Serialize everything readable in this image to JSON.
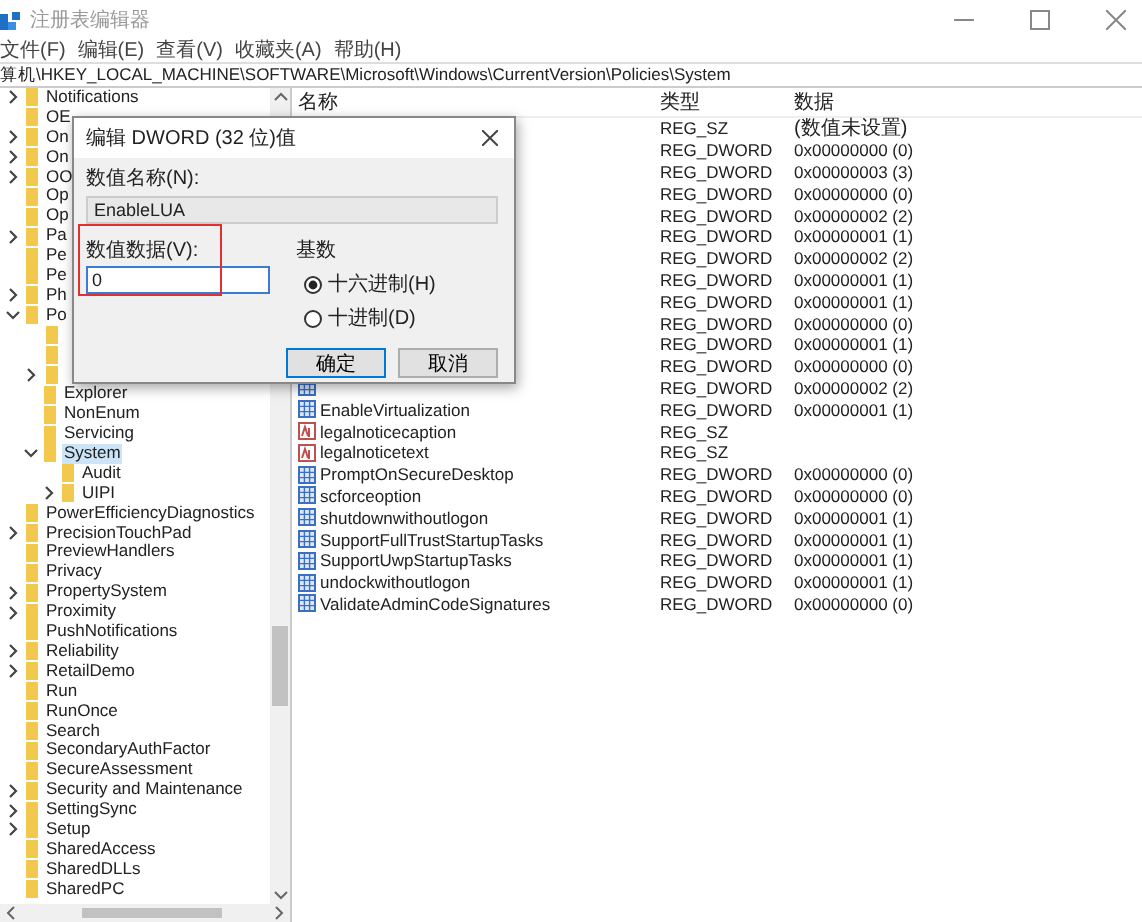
{
  "window": {
    "title": "注册表编辑器"
  },
  "menu": [
    "文件(F)",
    "编辑(E)",
    "查看(V)",
    "收藏夹(A)",
    "帮助(H)"
  ],
  "address": "算机\\HKEY_LOCAL_MACHINE\\SOFTWARE\\Microsoft\\Windows\\CurrentVersion\\Policies\\System",
  "tree": [
    {
      "name": "Notifications",
      "expanded": false,
      "selected": false
    },
    {
      "name": "OE",
      "selected": false
    },
    {
      "name": "On",
      "expanded": false,
      "selected": false
    },
    {
      "name": "On",
      "expanded": false,
      "selected": false
    },
    {
      "name": "OO",
      "expanded": false,
      "selected": false
    },
    {
      "name": "Op",
      "selected": false
    },
    {
      "name": "Op",
      "selected": false
    },
    {
      "name": "Pa",
      "expanded": false,
      "selected": false
    },
    {
      "name": "Pe",
      "selected": false
    },
    {
      "name": "Pe",
      "selected": false
    },
    {
      "name": "Ph",
      "expanded": false,
      "selected": false
    },
    {
      "name": "Po",
      "expanded": true,
      "selected": false,
      "children": [
        {
          "selected": false
        },
        {
          "selected": false
        },
        {
          "expanded": false,
          "selected": false
        },
        {
          "name": "Explorer",
          "selected": false
        },
        {
          "name": "NonEnum",
          "selected": false
        },
        {
          "name": "Servicing",
          "selected": false
        },
        {
          "name": "System",
          "expanded": true,
          "selected": true,
          "children": [
            {
              "name": "Audit",
              "selected": false
            },
            {
              "name": "UIPI",
              "expanded": false,
              "selected": false
            }
          ]
        }
      ]
    },
    {
      "name": "PowerEfficiencyDiagnostics",
      "selected": false
    },
    {
      "name": "PrecisionTouchPad",
      "expanded": false,
      "selected": false
    },
    {
      "name": "PreviewHandlers",
      "selected": false
    },
    {
      "name": "Privacy",
      "selected": false
    },
    {
      "name": "PropertySystem",
      "expanded": false,
      "selected": false
    },
    {
      "name": "Proximity",
      "expanded": false,
      "selected": false
    },
    {
      "name": "PushNotifications",
      "selected": false
    },
    {
      "name": "Reliability",
      "expanded": false,
      "selected": false
    },
    {
      "name": "RetailDemo",
      "expanded": false,
      "selected": false
    },
    {
      "name": "Run",
      "selected": false
    },
    {
      "name": "RunOnce",
      "selected": false
    },
    {
      "name": "Search",
      "selected": false
    },
    {
      "name": "SecondaryAuthFactor",
      "selected": false
    },
    {
      "name": "SecureAssessment",
      "selected": false
    },
    {
      "name": "Security and Maintenance",
      "expanded": false,
      "selected": false
    },
    {
      "name": "SettingSync",
      "expanded": false,
      "selected": false
    },
    {
      "name": "Setup",
      "expanded": false,
      "selected": false
    },
    {
      "name": "SharedAccess",
      "selected": false
    },
    {
      "name": "SharedDLLs",
      "selected": false
    },
    {
      "name": "SharedPC",
      "selected": false
    }
  ],
  "list": {
    "columns": [
      "名称",
      "类型",
      "数据"
    ],
    "rows": [
      {
        "type": "REG_SZ",
        "data": "(数值未设置)"
      },
      {
        "type": "REG_DWORD",
        "data": "0x00000000 (0)"
      },
      {
        "type": "REG_DWORD",
        "data": "0x00000003 (3)"
      },
      {
        "type": "REG_DWORD",
        "data": "0x00000000 (0)"
      },
      {
        "type": "REG_DWORD",
        "data": "0x00000002 (2)"
      },
      {
        "type": "REG_DWORD",
        "data": "0x00000001 (1)"
      },
      {
        "type": "REG_DWORD",
        "data": "0x00000002 (2)"
      },
      {
        "type": "REG_DWORD",
        "data": "0x00000001 (1)"
      },
      {
        "type": "REG_DWORD",
        "data": "0x00000001 (1)"
      },
      {
        "type": "REG_DWORD",
        "data": "0x00000000 (0)"
      },
      {
        "type": "REG_DWORD",
        "data": "0x00000001 (1)"
      },
      {
        "type": "REG_DWORD",
        "data": "0x00000000 (0)"
      },
      {
        "kind": "dword",
        "type": "REG_DWORD",
        "data": "0x00000002 (2)"
      },
      {
        "kind": "dword",
        "name": "EnableVirtualization",
        "type": "REG_DWORD",
        "data": "0x00000001 (1)"
      },
      {
        "kind": "string",
        "name": "legalnoticecaption",
        "type": "REG_SZ"
      },
      {
        "kind": "string",
        "name": "legalnoticetext",
        "type": "REG_SZ"
      },
      {
        "kind": "dword",
        "name": "PromptOnSecureDesktop",
        "type": "REG_DWORD",
        "data": "0x00000000 (0)"
      },
      {
        "kind": "dword",
        "name": "scforceoption",
        "type": "REG_DWORD",
        "data": "0x00000000 (0)"
      },
      {
        "kind": "dword",
        "name": "shutdownwithoutlogon",
        "type": "REG_DWORD",
        "data": "0x00000001 (1)"
      },
      {
        "kind": "dword",
        "name": "SupportFullTrustStartupTasks",
        "type": "REG_DWORD",
        "data": "0x00000001 (1)"
      },
      {
        "kind": "dword",
        "name": "SupportUwpStartupTasks",
        "type": "REG_DWORD",
        "data": "0x00000001 (1)"
      },
      {
        "kind": "dword",
        "name": "undockwithoutlogon",
        "type": "REG_DWORD",
        "data": "0x00000001 (1)"
      },
      {
        "kind": "dword",
        "name": "ValidateAdminCodeSignatures",
        "type": "REG_DWORD",
        "data": "0x00000000 (0)"
      }
    ]
  },
  "dialog": {
    "title": "编辑 DWORD (32 位)值",
    "name_label": "数值名称(N):",
    "name_value": "EnableLUA",
    "data_label": "数值数据(V):",
    "data_value": "0",
    "data_highlighted": true,
    "base_label": "基数",
    "bases": [
      {
        "label": "十六进制(H)",
        "selected": true
      },
      {
        "label": "十进制(D)",
        "selected": false
      }
    ],
    "buttons": [
      {
        "label": "确定",
        "default": true
      },
      {
        "label": "取消",
        "default": false
      }
    ]
  }
}
